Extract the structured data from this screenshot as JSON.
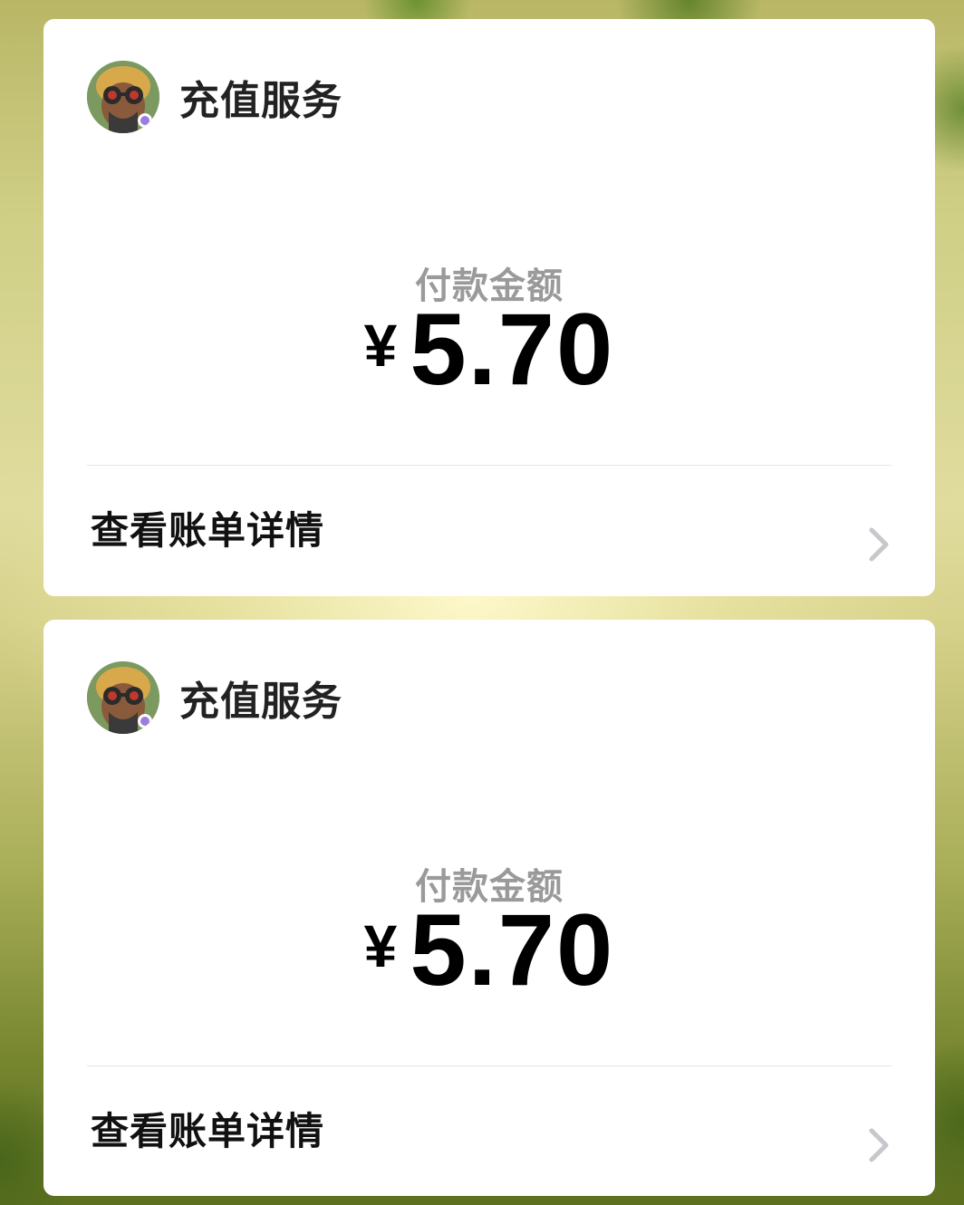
{
  "cards": [
    {
      "merchant_name": "充值服务",
      "amount_label": "付款金额",
      "currency_symbol": "¥",
      "amount": "5.70",
      "details_label": "查看账单详情",
      "avatar_icon": "game-character-avatar",
      "chevron_icon": "chevron-right-icon"
    },
    {
      "merchant_name": "充值服务",
      "amount_label": "付款金额",
      "currency_symbol": "¥",
      "amount": "5.70",
      "details_label": "查看账单详情",
      "avatar_icon": "game-character-avatar",
      "chevron_icon": "chevron-right-icon"
    }
  ],
  "colors": {
    "card_background": "#ffffff",
    "amount_label": "#9a9a9a",
    "amount_text": "#000000",
    "chevron": "#c7c7cc",
    "divider": "#e6e6e6"
  }
}
